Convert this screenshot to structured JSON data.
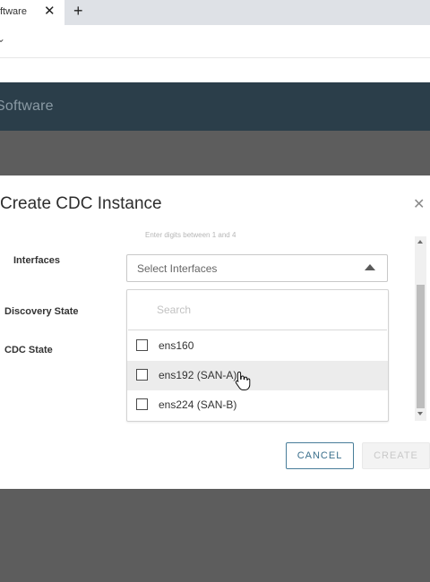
{
  "browser": {
    "tab_title": "ftware",
    "tab_close_glyph": "✕",
    "new_tab_glyph": "+",
    "address_glyph": "⌄"
  },
  "app": {
    "brand": "Software"
  },
  "modal": {
    "title": "Create CDC Instance",
    "close_glyph": "✕",
    "faded_hint": "Enter digits between 1 and 4",
    "fields": {
      "interfaces_label": "Interfaces",
      "discovery_state_label": "Discovery State",
      "cdc_state_label": "CDC State"
    },
    "interfaces_select": {
      "placeholder": "Select Interfaces",
      "expanded": true,
      "search_placeholder": "Search",
      "options": [
        {
          "label": "ens160",
          "checked": false,
          "hovered": false
        },
        {
          "label": "ens192 (SAN-A)",
          "checked": false,
          "hovered": true
        },
        {
          "label": "ens224 (SAN-B)",
          "checked": false,
          "hovered": false
        }
      ]
    },
    "buttons": {
      "cancel": "CANCEL",
      "create": "CREATE"
    }
  },
  "colors": {
    "header_bg": "#2b3e4a",
    "overlay": "#5d5d5d",
    "accent": "#3a6f8c",
    "hover_row": "#ececec"
  }
}
